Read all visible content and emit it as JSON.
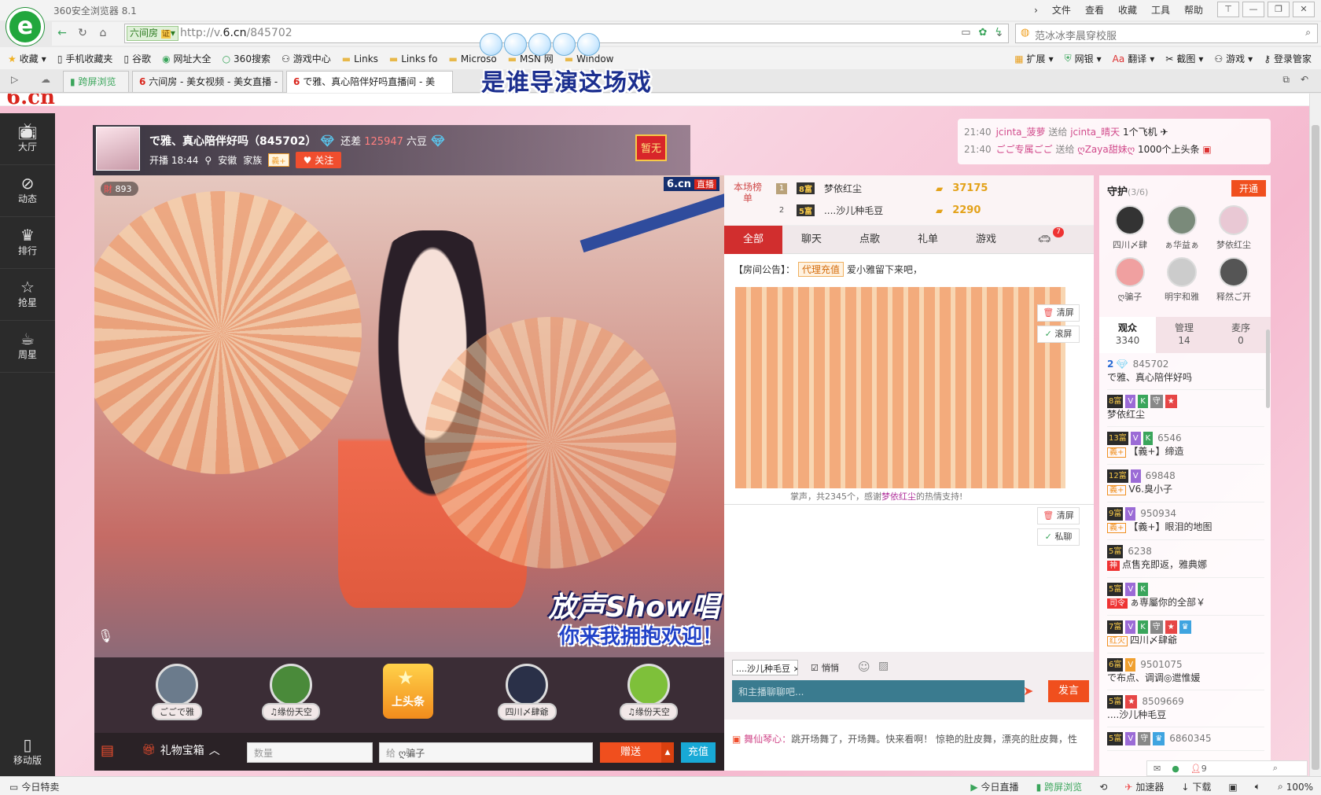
{
  "browser": {
    "app_title": "360安全浏览器 8.1",
    "logo_glyph": "e",
    "menus": [
      "文件",
      "查看",
      "收藏",
      "工具",
      "帮助"
    ],
    "room_tag": "六间房",
    "room_tag_badge": "证",
    "url_prefix": "http://v.",
    "url_host": "6.cn",
    "url_path": "/845702",
    "search_text": "范冰冰李晨穿校服",
    "favorites": [
      "收藏",
      "手机收藏夹",
      "谷歌",
      "网址大全",
      "360搜索",
      "游戏中心",
      "Links",
      "Links fo",
      "Microso",
      "MSN 网",
      "Window"
    ],
    "tools": [
      "扩展",
      "网银",
      "翻译",
      "截图",
      "游戏",
      "登录管家"
    ],
    "tabs": [
      {
        "label": "跨屏浏览",
        "active": false
      },
      {
        "label": "六间房 - 美女视频 - 美女直播 -",
        "active": false
      },
      {
        "label": "で雅、真心陪伴好吗直播间 - 美",
        "active": true
      }
    ]
  },
  "overlay_caption": "是谁导演这场戏",
  "site": {
    "logo": "6.cn",
    "left_nav": [
      {
        "label": "大厅",
        "icon": "tv-icon"
      },
      {
        "label": "动态",
        "icon": "compass-icon"
      },
      {
        "label": "排行",
        "icon": "crown-icon"
      },
      {
        "label": "抢星",
        "icon": "star-icon"
      },
      {
        "label": "周星",
        "icon": "cup-icon"
      }
    ],
    "mobile_label": "移动版"
  },
  "host": {
    "name_line": "で雅、真心陪伴好吗（845702）",
    "need_label": "还差",
    "need_value": "125947",
    "need_unit": "六豆",
    "live_time": "开播 18:44",
    "location": "安徽",
    "family_label": "家族",
    "family_tag": "義+",
    "follow_label": "关注",
    "badge_text": "暂无"
  },
  "ticker": [
    {
      "time": "21:40",
      "from": "jcinta_菠萝",
      "action": "送给",
      "to": "jcinta_晴天",
      "gift": "1个飞机"
    },
    {
      "time": "21:40",
      "from": "ごご专属ごご",
      "action": "送给",
      "to": "ღZaya甜妹ღ",
      "gift": "1000个上头条"
    }
  ],
  "video": {
    "viewers": "893",
    "brand": "6.cn",
    "live_tag": "直播",
    "show_logo": "放声Show唱",
    "subtitle": "你来我拥抱欢迎！"
  },
  "carousel": [
    {
      "label": "ごごで雅",
      "color": "#6b7b8c"
    },
    {
      "label": "♫缘份天空",
      "color": "#4a8a3a"
    },
    {
      "label": "四川〆肆爺",
      "color": "#2a3048"
    },
    {
      "label": "♫缘份天空",
      "color": "#7ec03a"
    }
  ],
  "hot_gift_label": "上头条",
  "gift_bar": {
    "box_label": "礼物宝箱",
    "qty_placeholder": "数量",
    "to_prefix": "给",
    "to_target": "ღ骗子",
    "send_label": "赠送",
    "recharge_label": "充值"
  },
  "rank": {
    "label": "本场榜单",
    "rows": [
      {
        "no": "1",
        "level": "8富",
        "name": "梦依红尘",
        "value": "37175"
      },
      {
        "no": "2",
        "level": "5富",
        "name": "....沙儿种毛豆",
        "value": "2290"
      }
    ]
  },
  "chat_tabs": [
    "全部",
    "聊天",
    "点歌",
    "礼单",
    "游戏"
  ],
  "chat_tab_badge": "7",
  "announcement": {
    "label": "【房间公告】：",
    "tag": "代理充值",
    "text": "爱小雅留下来吧，"
  },
  "applause": {
    "prefix": "掌声，共2345个，感谢",
    "user": "梦依红尘",
    "suffix": "的热情支持!"
  },
  "side_buttons": {
    "clear": "清屏",
    "scroll": "滚屏",
    "clear2": "清屏",
    "private": "私聊"
  },
  "chat_message": {
    "user": "舞仙琴心：",
    "text": "跳开场舞了，开场舞。快来看啊！ 惊艳的肚皮舞，漂亮的肚皮舞，性"
  },
  "chat_input": {
    "target": "....沙儿种毛豆",
    "quiet_label": "悄悄",
    "placeholder": "和主播聊聊吧...",
    "send_label": "发言"
  },
  "guard": {
    "title": "守护",
    "count": "(3/6)",
    "open_label": "开通",
    "members": [
      "四川〆肆",
      "ぁ华益ぁ",
      "梦依红尘",
      "ღ骗子",
      "明宇和雅",
      "释然ご开"
    ]
  },
  "audience_tabs": [
    {
      "label": "观众",
      "count": "3340"
    },
    {
      "label": "管理",
      "count": "14"
    },
    {
      "label": "麦序",
      "count": "0"
    }
  ],
  "audience": [
    {
      "level": "2",
      "uid": "845702",
      "sub": "で雅、真心陪伴好吗",
      "badges": [],
      "tag": ""
    },
    {
      "level": "8富",
      "uid": "",
      "sub": "梦依红尘",
      "badges": [
        "V",
        "K",
        "守",
        "★"
      ],
      "tag": ""
    },
    {
      "level": "13富",
      "uid": "6546",
      "sub": "【義+】缔造",
      "badges": [
        "V",
        "K"
      ],
      "tag": "義+"
    },
    {
      "level": "12富",
      "uid": "69848",
      "sub": "V6.臭小子",
      "badges": [
        "V"
      ],
      "tag": "義+"
    },
    {
      "level": "9富",
      "uid": "950934",
      "sub": "【義+】眼泪的地图",
      "badges": [
        "V"
      ],
      "tag": "義+"
    },
    {
      "level": "5富",
      "uid": "6238",
      "sub": "点售充即返，雅典娜",
      "badges": [],
      "tag": "神"
    },
    {
      "level": "5富",
      "uid": "",
      "sub": "ぁ専屬你的全部￥",
      "badges": [
        "V",
        "K"
      ],
      "tag": "司令"
    },
    {
      "level": "7富",
      "uid": "",
      "sub": "四川〆肆爺",
      "badges": [
        "V",
        "K",
        "守",
        "★",
        "♛"
      ],
      "tag": "红火"
    },
    {
      "level": "6富",
      "uid": "9501075",
      "sub": "で布点、调调◎迣惟媛",
      "badges": [
        "V"
      ],
      "tag": ""
    },
    {
      "level": "5富",
      "uid": "8509669",
      "sub": "....沙儿种毛豆",
      "badges": [
        "★"
      ],
      "tag": ""
    },
    {
      "level": "5富",
      "uid": "6860345",
      "sub": "",
      "badges": [
        "V",
        "守",
        "♛"
      ],
      "tag": ""
    }
  ],
  "right_footer": {
    "online": "9"
  },
  "status": {
    "left": "今日特卖",
    "items": [
      "今日直播",
      "跨屏浏览",
      "加速器",
      "下载"
    ],
    "zoom": "100%"
  }
}
